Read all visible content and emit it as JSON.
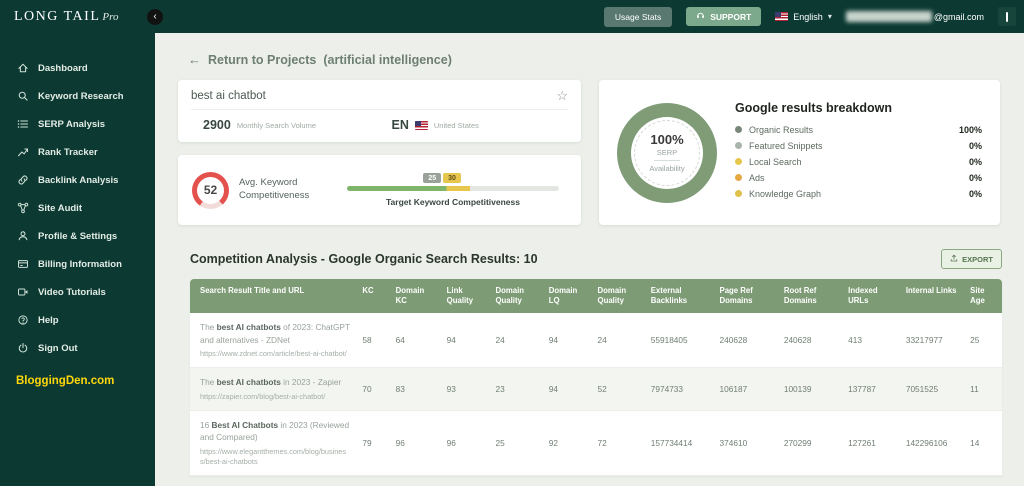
{
  "brand": {
    "name": "LONG TAIL",
    "suffix": "Pro"
  },
  "icons": {
    "back_arrow": "←",
    "star": "☆",
    "caret_down": "▾",
    "collapse": "‹"
  },
  "topbar": {
    "usage_stats_label": "Usage Stats",
    "support_label": "SUPPORT",
    "language": "English",
    "email_domain": "@gmail.com"
  },
  "sidebar": {
    "items": [
      {
        "id": "dashboard",
        "label": "Dashboard",
        "icon": "dashboard-icon"
      },
      {
        "id": "keyword-research",
        "label": "Keyword Research",
        "icon": "search-icon"
      },
      {
        "id": "serp-analysis",
        "label": "SERP Analysis",
        "icon": "serp-list-icon"
      },
      {
        "id": "rank-tracker",
        "label": "Rank Tracker",
        "icon": "rank-chart-icon"
      },
      {
        "id": "backlink-analysis",
        "label": "Backlink Analysis",
        "icon": "backlink-icon"
      },
      {
        "id": "site-audit",
        "label": "Site Audit",
        "icon": "site-audit-icon"
      },
      {
        "id": "profile-settings",
        "label": "Profile & Settings",
        "icon": "profile-icon"
      },
      {
        "id": "billing-information",
        "label": "Billing Information",
        "icon": "billing-icon"
      },
      {
        "id": "video-tutorials",
        "label": "Video Tutorials",
        "icon": "video-icon"
      },
      {
        "id": "help",
        "label": "Help",
        "icon": "help-icon"
      },
      {
        "id": "sign-out",
        "label": "Sign Out",
        "icon": "signout-icon"
      }
    ],
    "footer_link": "BloggingDen.com"
  },
  "main": {
    "back": {
      "label": "Return to Projects",
      "project": "(artificial intelligence)"
    },
    "keyword_card": {
      "keyword": "best ai chatbot",
      "volume": "2900",
      "volume_label": "Monthly Search Volume",
      "language_code": "EN",
      "country": "United States"
    },
    "competitiveness": {
      "score": "52",
      "label": "Avg. Keyword Competitiveness",
      "marker_low": "25",
      "marker_high": "30",
      "target_label": "Target Keyword Competitiveness"
    },
    "breakdown": {
      "title": "Google results breakdown",
      "donut_value": "100%",
      "donut_label_line1": "SERP",
      "donut_label_line2": "Availability",
      "legend": [
        {
          "label": "Organic Results",
          "value": "100%",
          "color": "#79877b"
        },
        {
          "label": "Featured Snippets",
          "value": "0%",
          "color": "#a9b4aa"
        },
        {
          "label": "Local Search",
          "value": "0%",
          "color": "#e7c64e"
        },
        {
          "label": "Ads",
          "value": "0%",
          "color": "#e5a944"
        },
        {
          "label": "Knowledge Graph",
          "value": "0%",
          "color": "#dfc049"
        }
      ]
    },
    "competition": {
      "title": "Competition Analysis - Google Organic Search Results: 10",
      "export_label": "EXPORT",
      "headers": [
        "Search Result Title and URL",
        "KC",
        "Domain KC",
        "Link Quality",
        "Domain Quality",
        "Domain LQ",
        "Domain Quality",
        "External Backlinks",
        "Page Ref Domains",
        "Root Ref Domains",
        "Indexed URLs",
        "Internal Links",
        "Site Age"
      ],
      "rows": [
        {
          "title_pre": "The ",
          "title_bold": "best AI chatbots",
          "title_post": " of 2023: ChatGPT and alternatives - ZDNet",
          "url": "https://www.zdnet.com/article/best-ai-chatbot/",
          "values": [
            "58",
            "64",
            "94",
            "24",
            "94",
            "24",
            "55918405",
            "240628",
            "240628",
            "413",
            "33217977",
            "25"
          ]
        },
        {
          "title_pre": "The ",
          "title_bold": "best AI chatbots",
          "title_post": " in 2023 - Zapier",
          "url": "https://zapier.com/blog/best-ai-chatbot/",
          "values": [
            "70",
            "83",
            "93",
            "23",
            "94",
            "52",
            "7974733",
            "106187",
            "100139",
            "137787",
            "7051525",
            "11"
          ]
        },
        {
          "title_pre": "16 ",
          "title_bold": "Best AI Chatbots",
          "title_post": " in 2023 (Reviewed and Compared)",
          "url": "https://www.elegantthemes.com/blog/business/best-ai-chatbots",
          "values": [
            "79",
            "96",
            "96",
            "25",
            "92",
            "72",
            "157734414",
            "374610",
            "270299",
            "127261",
            "142296106",
            "14"
          ]
        }
      ]
    }
  },
  "colors": {
    "sidebar_bg": "#0c3a33",
    "accent_green": "#7d9b74",
    "accent_yellow": "#e7c64e",
    "accent_red": "#e4524e",
    "footer_yellow": "#ffd60a"
  }
}
